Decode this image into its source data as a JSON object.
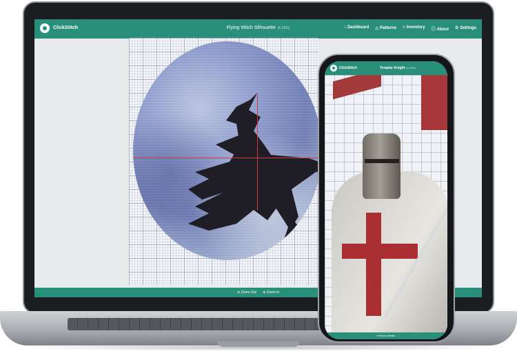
{
  "desktop": {
    "brand": "ClickStitch",
    "pattern_title": "Flying Witch Silhouette",
    "pattern_sub": "(0.16%)",
    "nav": [
      {
        "icon": "dashboard-icon",
        "glyph": "⌂",
        "label": "Dashboard"
      },
      {
        "icon": "patterns-icon",
        "glyph": "△",
        "label": "Patterns"
      },
      {
        "icon": "inventory-icon",
        "glyph": "≡",
        "label": "Inventory"
      },
      {
        "icon": "about-icon",
        "glyph": "ⓘ",
        "label": "About"
      },
      {
        "icon": "settings-icon",
        "glyph": "⚙",
        "label": "Settings"
      }
    ],
    "footer": {
      "zoom_out": "⊖ Zoom Out",
      "zoom_in": "⊕ Zoom In"
    }
  },
  "phone": {
    "brand": "ClickStitch",
    "pattern_title": "Templar Knight",
    "pattern_sub": "(0.43%)",
    "footer_button": "▾ Show Details"
  },
  "colors": {
    "accent": "#2a8f7a",
    "crosshair": "#d43a3a"
  }
}
